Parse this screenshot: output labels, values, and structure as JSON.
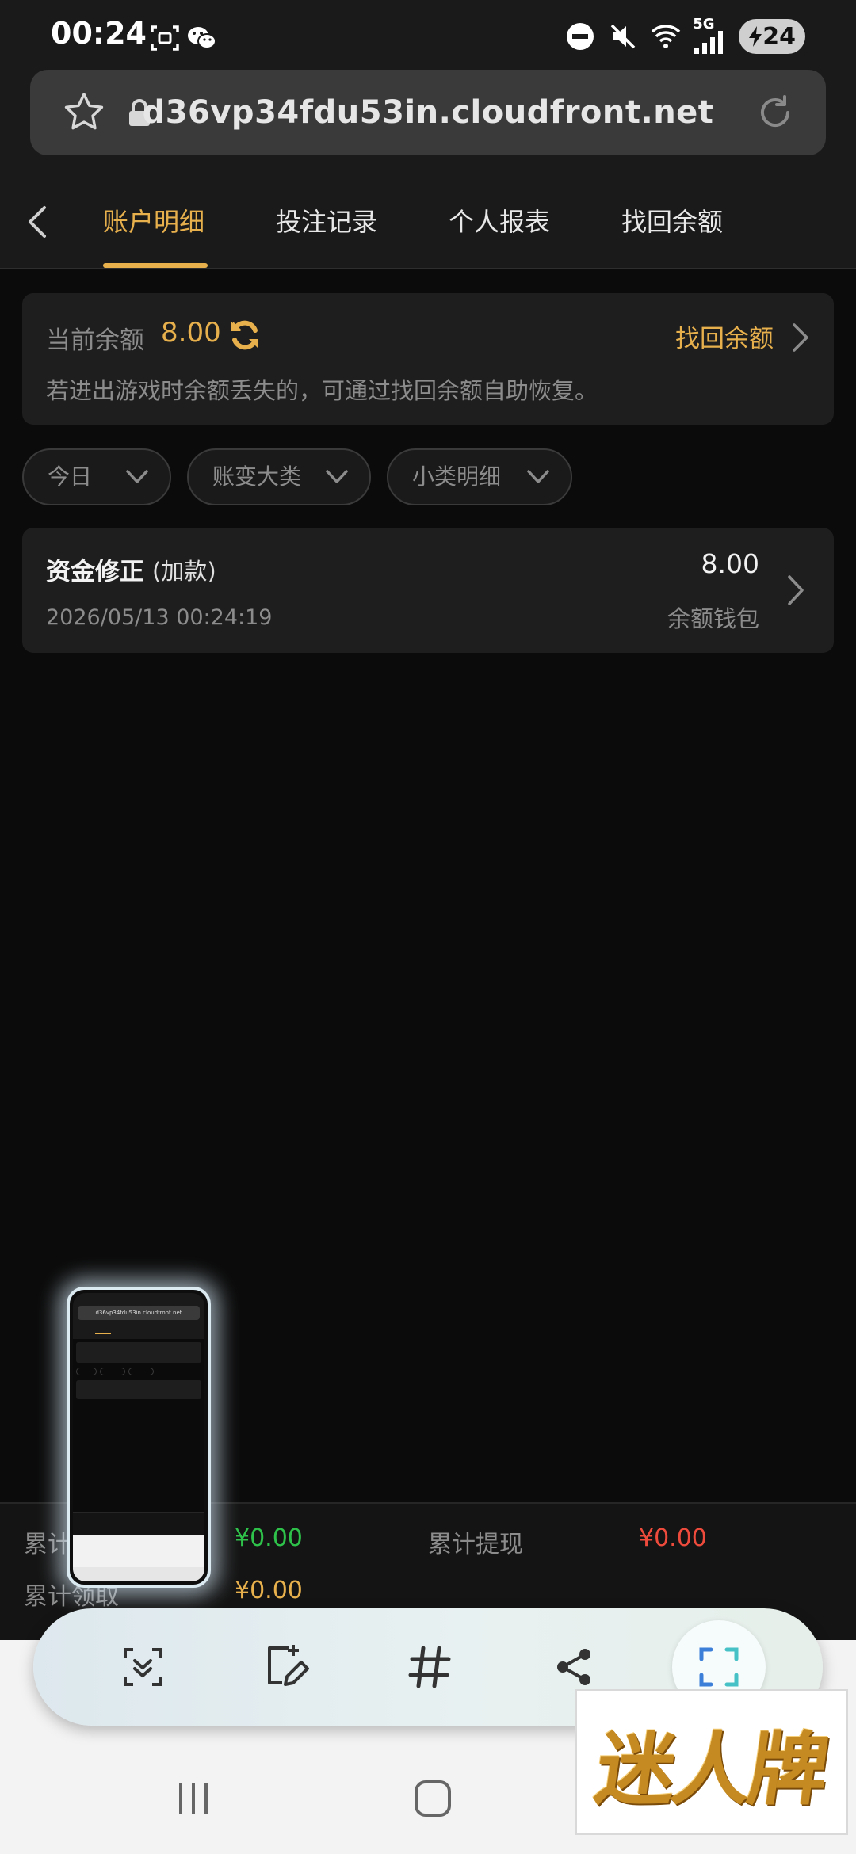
{
  "status_bar": {
    "time": "00:24",
    "network": "5G",
    "battery": "24"
  },
  "browser": {
    "url": "d36vp34fdu53in.cloudfront.net"
  },
  "tabs": [
    {
      "label": "账户明细",
      "active": true
    },
    {
      "label": "投注记录",
      "active": false
    },
    {
      "label": "个人报表",
      "active": false
    },
    {
      "label": "找回余额",
      "active": false
    }
  ],
  "balance": {
    "label": "当前余额",
    "value": "8.00",
    "recover_label": "找回余额",
    "note": "若进出游戏时余额丢失的，可通过找回余额自助恢复。"
  },
  "filters": [
    {
      "label": "今日"
    },
    {
      "label": "账变大类"
    },
    {
      "label": "小类明细"
    }
  ],
  "transactions": [
    {
      "title": "资金修正",
      "subtype": "(加款)",
      "time": "2026/05/13 00:24:19",
      "amount": "8.00",
      "wallet": "余额钱包"
    }
  ],
  "summary": {
    "items": [
      {
        "label": "累计",
        "value": "¥0.00"
      },
      {
        "label": "累计提现",
        "value": "¥0.00"
      },
      {
        "label": "累计领取",
        "value": "¥0.00"
      }
    ]
  },
  "thumbnail": {
    "url": "d36vp34fdu53in.cloudfront.net"
  },
  "screenshot_toolbar": {
    "tools": [
      "scroll-capture-icon",
      "draw-icon",
      "hashtag-icon",
      "share-icon",
      "crop-icon"
    ]
  },
  "watermark": {
    "text": "迷人牌"
  },
  "colors": {
    "accent": "#e7b04d",
    "green": "#2ec24a",
    "red": "#ef4b3c",
    "background": "#0b0b0b"
  }
}
